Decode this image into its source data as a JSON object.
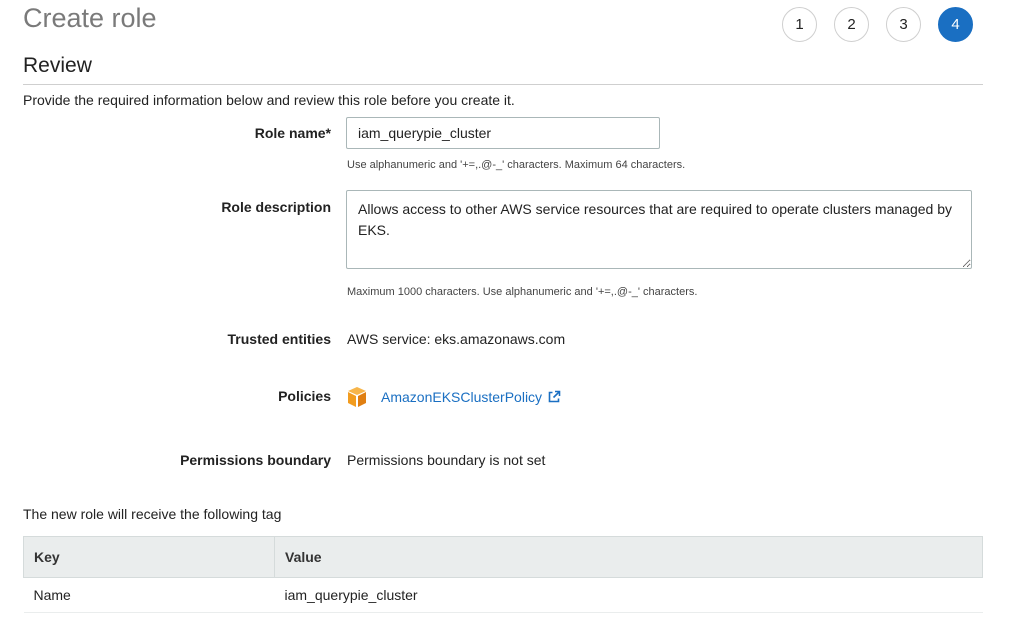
{
  "header": {
    "title": "Create role",
    "steps": [
      "1",
      "2",
      "3",
      "4"
    ],
    "active_step": "4"
  },
  "section": {
    "title": "Review",
    "intro": "Provide the required information below and review this role before you create it."
  },
  "form": {
    "role_name": {
      "label": "Role name*",
      "value": "iam_querypie_cluster",
      "hint": "Use alphanumeric and '+=,.@-_' characters. Maximum 64 characters."
    },
    "role_description": {
      "label": "Role description",
      "value": "Allows access to other AWS service resources that are required to operate clusters managed by EKS.",
      "hint": "Maximum 1000 characters. Use alphanumeric and '+=,.@-_' characters."
    },
    "trusted_entities": {
      "label": "Trusted entities",
      "value": "AWS service: eks.amazonaws.com"
    },
    "policies": {
      "label": "Policies",
      "icon": "aws-policy-cube-icon",
      "items": [
        {
          "name": "AmazonEKSClusterPolicy",
          "link_icon": "external-link-icon"
        }
      ]
    },
    "permissions_boundary": {
      "label": "Permissions boundary",
      "value": "Permissions boundary is not set"
    }
  },
  "tags": {
    "intro": "The new role will receive the following tag",
    "columns": [
      "Key",
      "Value"
    ],
    "rows": [
      {
        "key": "Name",
        "value": "iam_querypie_cluster"
      }
    ]
  },
  "colors": {
    "accent": "#1a6fc2",
    "policy_icon": "#f29c1f",
    "table_header_bg": "#eaeded"
  }
}
